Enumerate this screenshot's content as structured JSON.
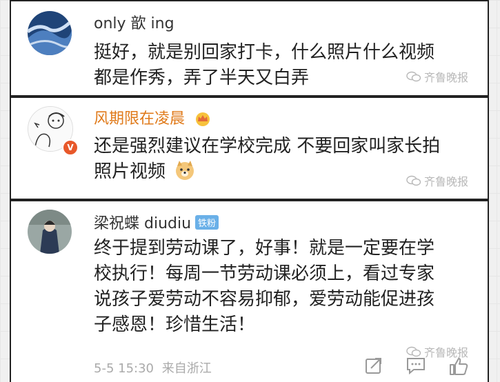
{
  "comments": [
    {
      "username": "only 歆 ing",
      "content_lines": [
        "挺好，就是别回家打卡，什么照片什么视频",
        "都是作秀，弄了半天又白弄"
      ],
      "watermark": "齐鲁晚报"
    },
    {
      "username": "风期限在凌晨",
      "content_lines": [
        "还是强烈建议在学校完成 不要回家叫家长拍",
        "照片视频"
      ],
      "watermark": "齐鲁晚报",
      "avatar_badge": "V",
      "crown_icon": "crown-icon",
      "emoji": "doge-emoji"
    },
    {
      "username": "梁祝蝶 diudiu",
      "badge": "铁粉",
      "content_lines": [
        "终于提到劳动课了，好事！就是一定要在学",
        "校执行！每周一节劳动课必须上，看过专家",
        "说孩子爱劳动不容易抑郁，爱劳动能促进孩",
        "子感恩！珍惜生活！"
      ],
      "timestamp": "5-5 15:30",
      "source": "来自浙江",
      "watermark": "齐鲁晚报"
    }
  ],
  "colors": {
    "username_default": "#333333",
    "username_vip": "#e07a1a",
    "fan_badge": "#6ab0e8",
    "meta": "#aaaaaa",
    "watermark": "#b8b8b8"
  },
  "icons": [
    "share-icon",
    "comment-icon",
    "like-icon",
    "wechat-icon"
  ]
}
